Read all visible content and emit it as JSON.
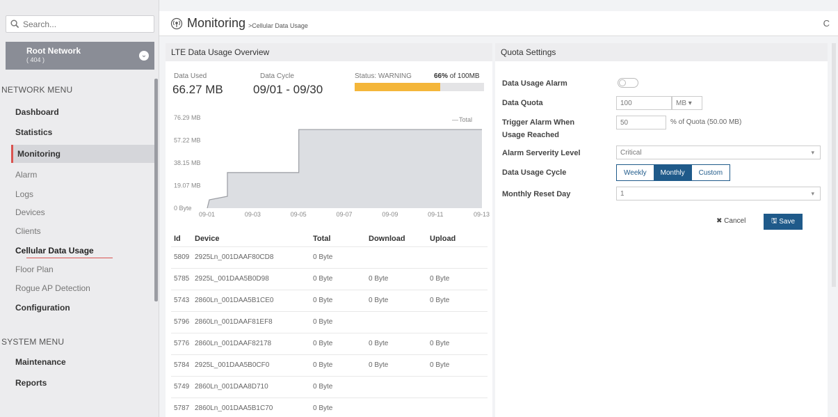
{
  "sidebar": {
    "search_placeholder": "Search...",
    "root": {
      "title": "Root Network",
      "sub": "( 404 )"
    },
    "network_menu_label": "NETWORK MENU",
    "items": [
      {
        "label": "Dashboard"
      },
      {
        "label": "Statistics"
      },
      {
        "label": "Monitoring"
      },
      {
        "label": "Alarm"
      },
      {
        "label": "Logs"
      },
      {
        "label": "Devices"
      },
      {
        "label": "Clients"
      },
      {
        "label": "Cellular Data Usage"
      },
      {
        "label": "Floor Plan"
      },
      {
        "label": "Rogue AP Detection"
      },
      {
        "label": "Configuration"
      }
    ],
    "system_menu_label": "SYSTEM MENU",
    "system_items": [
      {
        "label": "Maintenance"
      },
      {
        "label": "Reports"
      }
    ]
  },
  "header": {
    "title": "Monitoring",
    "breadcrumb": ">Cellular Data Usage",
    "refresh": "C"
  },
  "overview": {
    "title": "LTE Data Usage Overview",
    "data_used_label": "Data Used",
    "data_used_value": "66.27 MB",
    "data_cycle_label": "Data Cycle",
    "data_cycle_value": "09/01 - 09/30",
    "status_label": "Status: WARNING",
    "percent_label": "66%",
    "percent_suffix": "of 100MB",
    "progress_fraction": 0.66,
    "accent": "#f4b63a"
  },
  "chart_data": {
    "type": "area",
    "legend": [
      "Total"
    ],
    "y_ticks": [
      "76.29 MB",
      "57.22 MB",
      "38.15 MB",
      "19.07 MB",
      "0 Byte"
    ],
    "x_ticks": [
      "09-01",
      "09-03",
      "09-05",
      "09-07",
      "09-09",
      "09-11",
      "09-13"
    ],
    "ylim": [
      0,
      76.29
    ],
    "series": [
      {
        "name": "Total",
        "x": [
          "09-01",
          "09-01",
          "09-02",
          "09-02",
          "09-05",
          "09-05",
          "09-14"
        ],
        "values": [
          0,
          7,
          10,
          30,
          30,
          66.27,
          66.27
        ]
      }
    ]
  },
  "table": {
    "headers": [
      "Id",
      "Device",
      "Total",
      "Download",
      "Upload"
    ],
    "rows": [
      [
        "5809",
        "2925Ln_001DAAF80CD8",
        "0 Byte",
        "",
        ""
      ],
      [
        "5785",
        "2925L_001DAA5B0D98",
        "0 Byte",
        "0 Byte",
        "0 Byte"
      ],
      [
        "5743",
        "2860Ln_001DAA5B1CE0",
        "0 Byte",
        "0 Byte",
        "0 Byte"
      ],
      [
        "5796",
        "2860Ln_001DAAF81EF8",
        "0 Byte",
        "",
        ""
      ],
      [
        "5776",
        "2860Ln_001DAAF82178",
        "0 Byte",
        "0 Byte",
        "0 Byte"
      ],
      [
        "5784",
        "2925L_001DAA5B0CF0",
        "0 Byte",
        "0 Byte",
        "0 Byte"
      ],
      [
        "5749",
        "2860Ln_001DAA8D710",
        "0 Byte",
        "",
        ""
      ],
      [
        "5787",
        "2860Ln_001DAA5B1C70",
        "0 Byte",
        "",
        ""
      ]
    ]
  },
  "quota": {
    "title": "Quota Settings",
    "alarm_label": "Data Usage Alarm",
    "quota_label": "Data Quota",
    "quota_value": "100",
    "quota_unit": "MB",
    "trigger_label": "Trigger Alarm When",
    "trigger_label2": "Usage Reached",
    "trigger_value": "50",
    "trigger_hint": "% of Quota (50.00 MB)",
    "severity_label": "Alarm Serverity Level",
    "severity_value": "Critical",
    "cycle_label": "Data Usage Cycle",
    "cycle_options": [
      "Weekly",
      "Monthly",
      "Custom"
    ],
    "reset_label": "Monthly Reset Day",
    "reset_value": "1",
    "cancel_label": "Cancel",
    "save_label": "Save"
  }
}
